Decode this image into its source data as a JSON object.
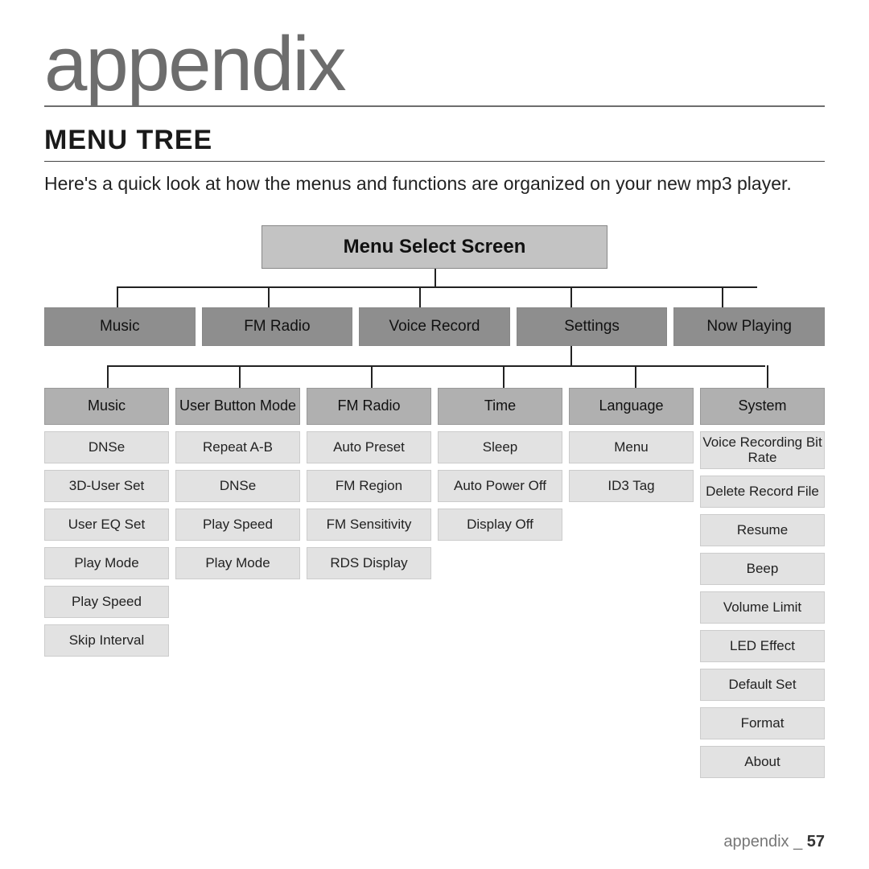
{
  "page_title": "appendix",
  "section_heading": "MENU TREE",
  "intro_text": "Here's a quick look at how the menus and functions are organized on your new mp3 player.",
  "root_label": "Menu Select Screen",
  "level1": [
    "Music",
    "FM Radio",
    "Voice Record",
    "Settings",
    "Now Playing"
  ],
  "columns": [
    {
      "header": "Music",
      "items": [
        "DNSe",
        "3D-User Set",
        "User EQ Set",
        "Play Mode",
        "Play Speed",
        "Skip Interval"
      ]
    },
    {
      "header": "User Button Mode",
      "items": [
        "Repeat A-B",
        "DNSe",
        "Play Speed",
        "Play Mode"
      ]
    },
    {
      "header": "FM Radio",
      "items": [
        "Auto Preset",
        "FM Region",
        "FM Sensitivity",
        "RDS Display"
      ]
    },
    {
      "header": "Time",
      "items": [
        "Sleep",
        "Auto Power Off",
        "Display Off"
      ]
    },
    {
      "header": "Language",
      "items": [
        "Menu",
        "ID3 Tag"
      ]
    },
    {
      "header": "System",
      "items": [
        "Voice Recording Bit Rate",
        "Delete Record File",
        "Resume",
        "Beep",
        "Volume Limit",
        "LED Effect",
        "Default Set",
        "Format",
        "About"
      ]
    }
  ],
  "footer_label": "appendix _ ",
  "footer_page": "57"
}
